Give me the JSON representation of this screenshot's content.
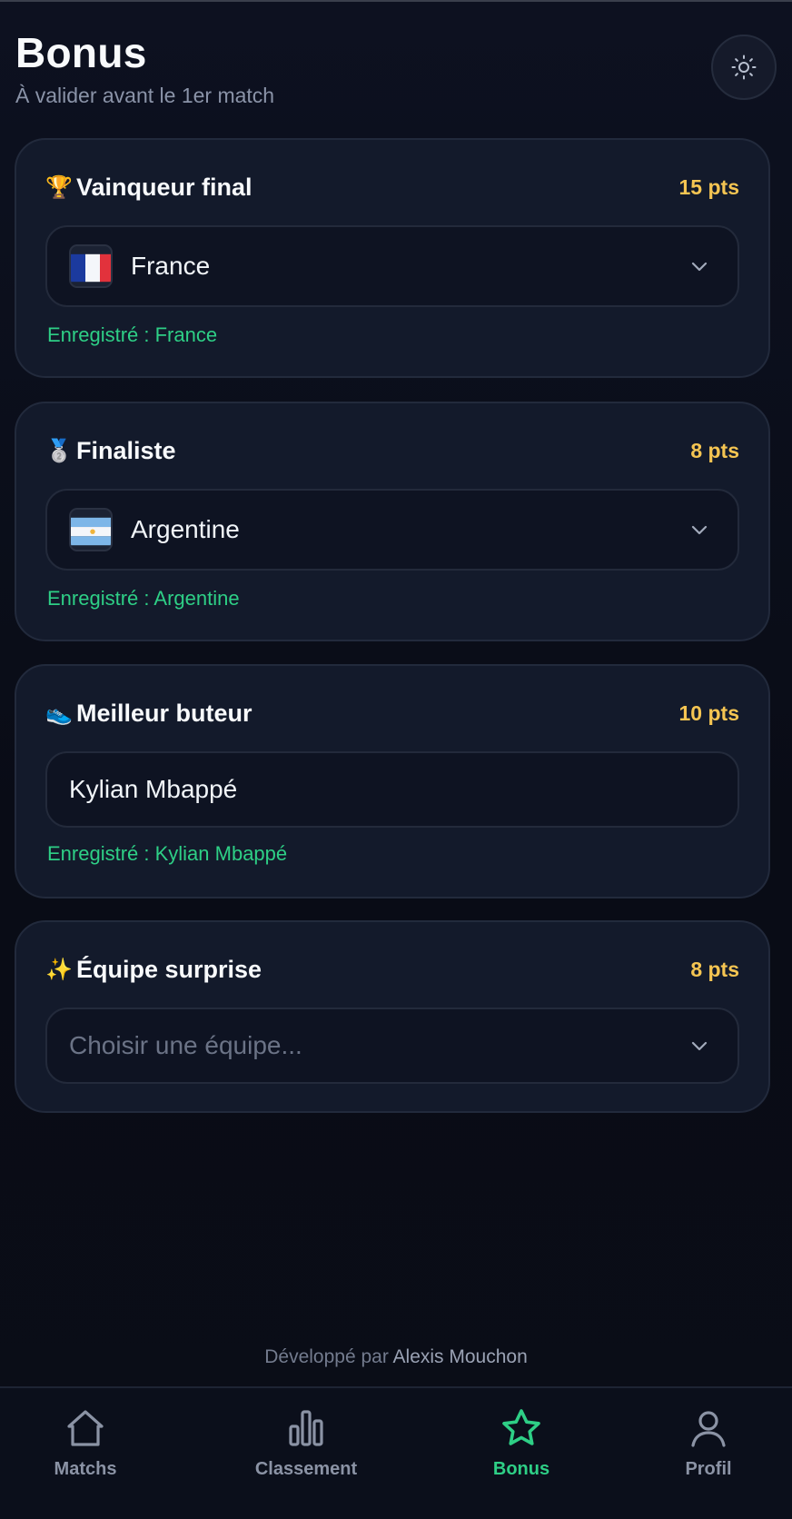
{
  "header": {
    "title": "Bonus",
    "subtitle": "À valider avant le 1er match"
  },
  "cards": [
    {
      "emoji": "🏆",
      "title": "Vainqueur final",
      "points": "15 pts",
      "value": "France",
      "saved": "Enregistré : France"
    },
    {
      "emoji": "🥈",
      "title": "Finaliste",
      "points": "8 pts",
      "value": "Argentine",
      "saved": "Enregistré : Argentine"
    },
    {
      "emoji": "👟",
      "title": "Meilleur buteur",
      "points": "10 pts",
      "value": "Kylian Mbappé",
      "saved": "Enregistré : Kylian Mbappé"
    },
    {
      "emoji": "✨",
      "title": "Équipe surprise",
      "points": "8 pts",
      "placeholder": "Choisir une équipe..."
    }
  ],
  "footer": {
    "credit_prefix": "Développé par",
    "credit_author": "Alexis Mouchon"
  },
  "nav": {
    "items": [
      {
        "label": "Matchs",
        "icon": "home-icon"
      },
      {
        "label": "Classement",
        "icon": "bar-chart-icon"
      },
      {
        "label": "Bonus",
        "icon": "star-icon",
        "active": true
      },
      {
        "label": "Profil",
        "icon": "user-icon"
      }
    ]
  },
  "colors": {
    "accent": "#2ecf86",
    "points": "#f5c552",
    "background": "#0b0e18",
    "card": "#131a2b"
  }
}
